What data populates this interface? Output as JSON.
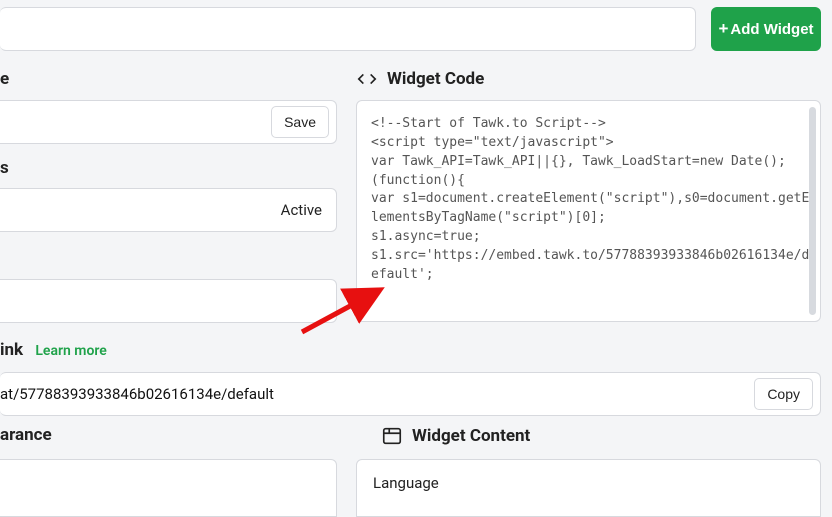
{
  "header": {
    "add_widget_label": "Add Widget",
    "add_widget_plus": "+"
  },
  "section_a": {
    "heading_fragment": "e",
    "save_label": "Save"
  },
  "section_b": {
    "heading_fragment": "s",
    "status_label": "Active"
  },
  "link_section": {
    "heading_fragment": "ink",
    "learn_label": "Learn more",
    "url_fragment": "at/57788393933846b02616134e/default",
    "copy_label": "Copy"
  },
  "widget_code": {
    "heading": "Widget Code",
    "code": "<!--Start of Tawk.to Script-->\n<script type=\"text/javascript\">\nvar Tawk_API=Tawk_API||{}, Tawk_LoadStart=new Date();\n(function(){\nvar s1=document.createElement(\"script\"),s0=document.getElementsByTagName(\"script\")[0];\ns1.async=true;\ns1.src='https://embed.tawk.to/57788393933846b02616134e/default';"
  },
  "appearance": {
    "heading_fragment": "arance"
  },
  "widget_content": {
    "heading": "Widget Content",
    "language_label": "Language"
  }
}
